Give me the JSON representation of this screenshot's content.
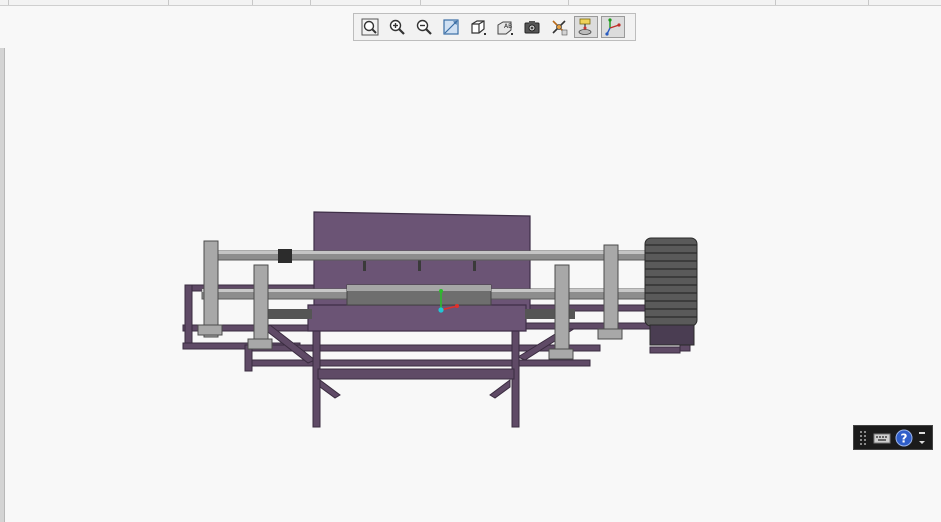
{
  "window": {
    "title": ""
  },
  "top_strip": {
    "separators": 8
  },
  "toolbar": {
    "buttons": [
      {
        "id": "fit-all",
        "icon": "fit-all-icon",
        "active": false
      },
      {
        "id": "zoom-in",
        "icon": "zoom-in-icon",
        "active": false
      },
      {
        "id": "zoom-out",
        "icon": "zoom-out-icon",
        "active": false
      },
      {
        "id": "normal-view",
        "icon": "normal-view-icon",
        "active": false
      },
      {
        "id": "view-orientation",
        "icon": "cube-view-icon",
        "active": false
      },
      {
        "id": "shading-style",
        "icon": "shading-style-icon",
        "active": false
      },
      {
        "id": "capture",
        "icon": "camera-icon",
        "active": false
      },
      {
        "id": "hide-show",
        "icon": "hide-show-icon",
        "active": false
      },
      {
        "id": "compass",
        "icon": "compass-icon",
        "active": true
      },
      {
        "id": "axis-system",
        "icon": "axis-system-icon",
        "active": true
      }
    ]
  },
  "viewport": {
    "model": "roller-machine-assembly",
    "colors": {
      "frame": "#5f4a66",
      "plate": "#6b5475",
      "shaft": "#8d8d8d",
      "axis_x": "#e0302a",
      "axis_y": "#2bbd2b",
      "axis_z": "#21c6d6"
    }
  },
  "mini_panel": {
    "items": [
      "grip-icon",
      "keyboard-icon",
      "help-icon",
      "menu-arrow-icon"
    ]
  }
}
